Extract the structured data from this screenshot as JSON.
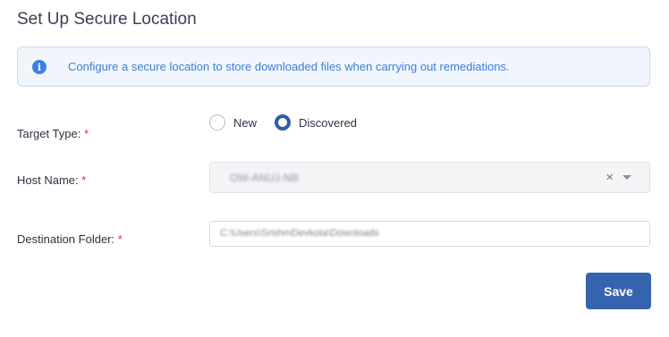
{
  "page": {
    "title": "Set Up Secure Location"
  },
  "info": {
    "icon": "info-icon",
    "glyph": "i",
    "text": "Configure a secure location to store downloaded files when carrying out remediations."
  },
  "form": {
    "target_type": {
      "label": "Target Type:",
      "required_mark": "*",
      "options": [
        {
          "label": "New",
          "selected": false
        },
        {
          "label": "Discovered",
          "selected": true
        }
      ]
    },
    "host_name": {
      "label": "Host Name:",
      "required_mark": "*",
      "value": "OW-ANUJ-NB",
      "clear_glyph": "×"
    },
    "destination_folder": {
      "label": "Destination Folder:",
      "required_mark": "*",
      "value": "C:\\Users\\SrishmDevkota\\Downloads"
    }
  },
  "actions": {
    "save_label": "Save"
  },
  "colors": {
    "accent": "#3563ad",
    "info_bg": "#f1f6fd",
    "info_text": "#3b7fd6",
    "required": "#d9342b"
  }
}
